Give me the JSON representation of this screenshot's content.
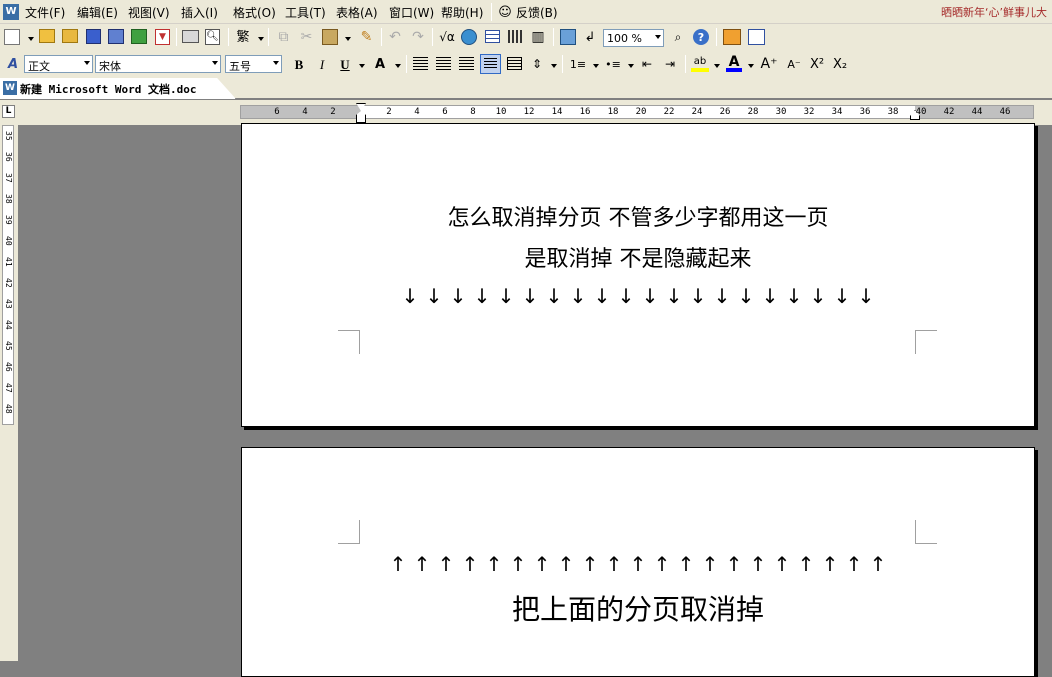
{
  "menubar": {
    "items": [
      "文件(F)",
      "编辑(E)",
      "视图(V)",
      "插入(I)",
      "格式(O)",
      "工具(T)",
      "表格(A)",
      "窗口(W)",
      "帮助(H)"
    ],
    "feedback": "反馈(B)",
    "right_text": "晒晒新年‘心’鲜事儿大"
  },
  "toolbar_standard": {
    "zoom": "100 %",
    "trad_chinese": "繁"
  },
  "toolbar_format": {
    "style": "正文",
    "font": "宋体",
    "size": "五号"
  },
  "doctab": {
    "title": "新建 Microsoft Word 文档.doc"
  },
  "ruler": {
    "h_labels": [
      "6",
      "4",
      "2",
      "2",
      "4",
      "6",
      "8",
      "10",
      "12",
      "14",
      "16",
      "18",
      "20",
      "22",
      "24",
      "26",
      "28",
      "30",
      "32",
      "34",
      "36",
      "38",
      "40",
      "42",
      "44",
      "46"
    ],
    "v_labels": [
      "35",
      "36",
      "37",
      "38",
      "39",
      "40",
      "41",
      "42",
      "43",
      "44",
      "45",
      "46",
      "47",
      "48"
    ]
  },
  "page1": {
    "line1": "怎么取消掉分页  不管多少字都用这一页",
    "line2": "是取消掉  不是隐藏起来",
    "arrow_glyph": "↓",
    "arrow_count": 20
  },
  "page2": {
    "arrow_glyph": "↑",
    "arrow_count": 21,
    "line1": "把上面的分页取消掉"
  }
}
